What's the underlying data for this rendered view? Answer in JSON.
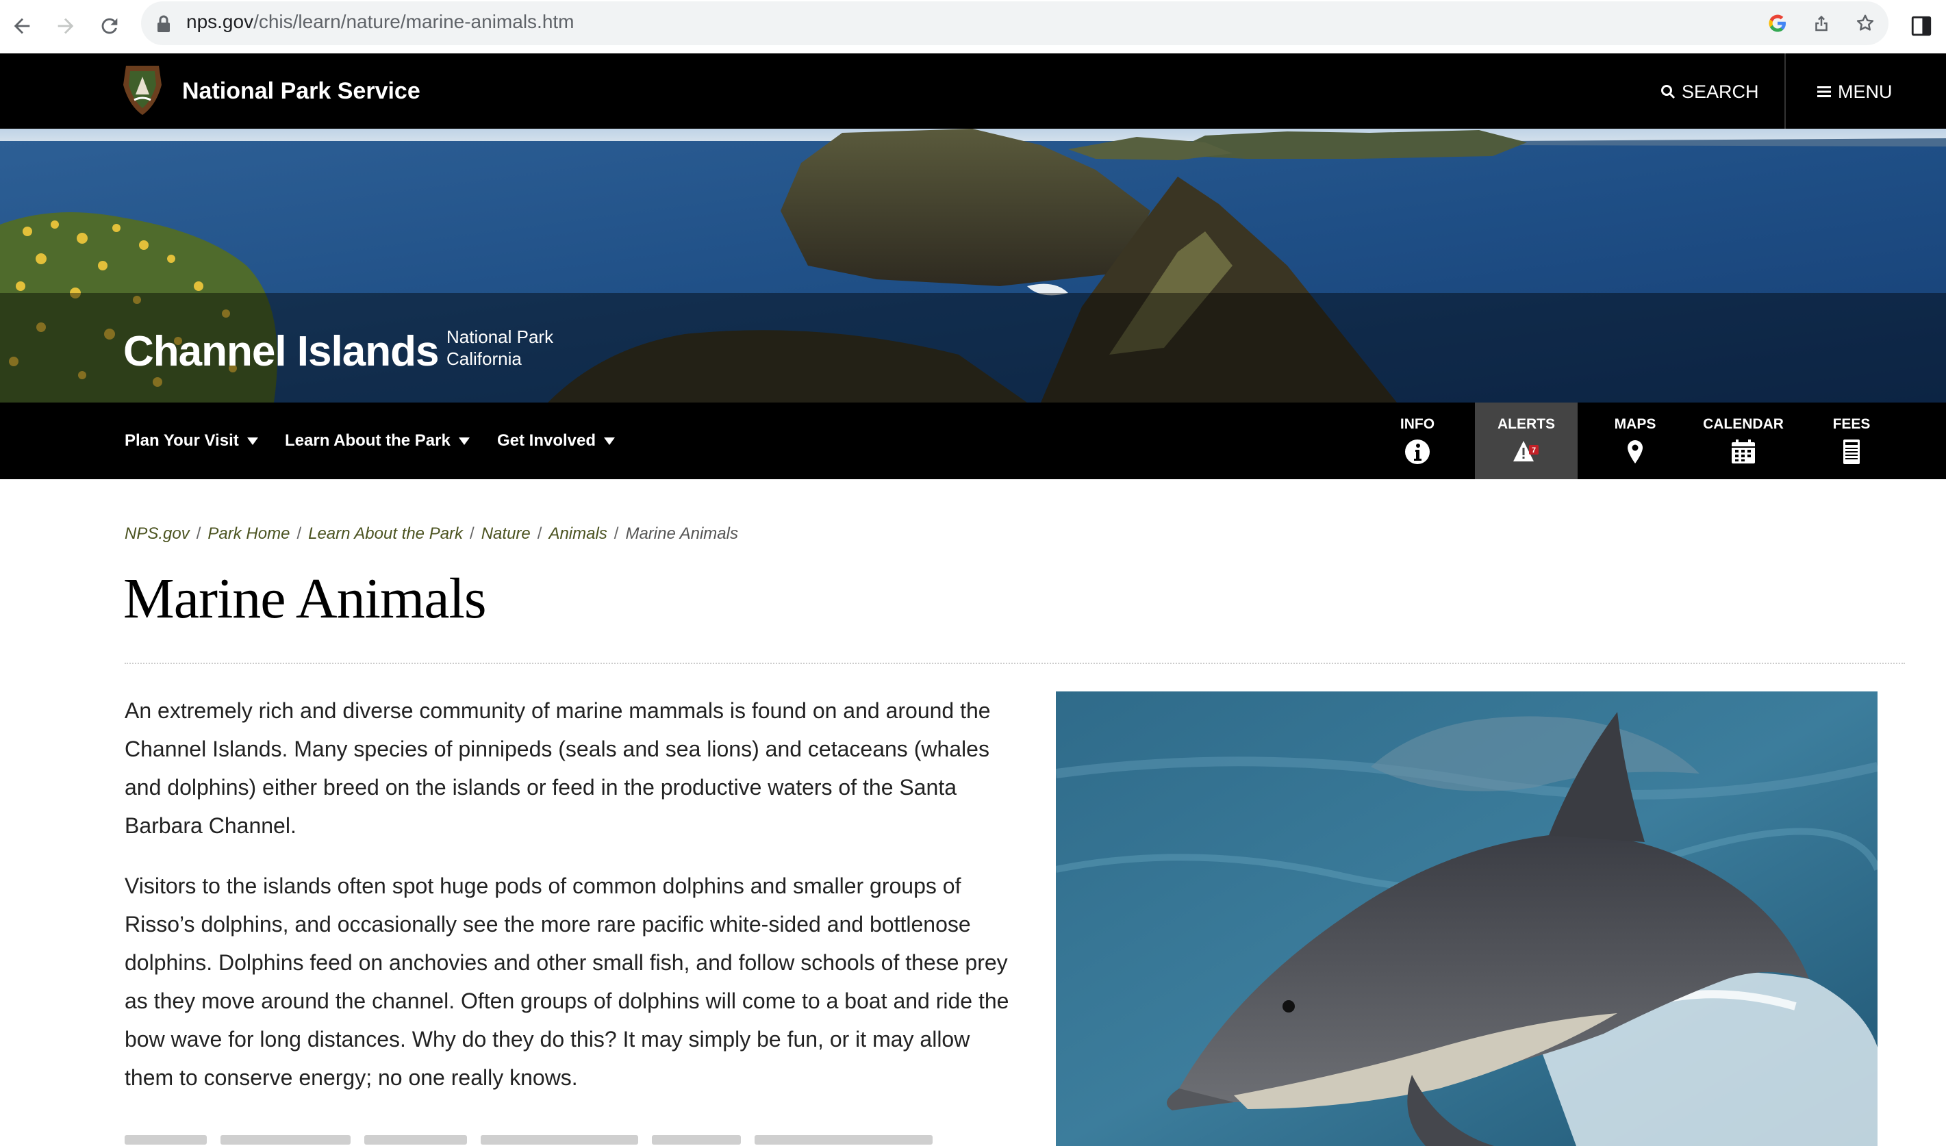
{
  "browser": {
    "url_host": "nps.gov",
    "url_path": "/chis/learn/nature/marine-animals.htm"
  },
  "header": {
    "site_name": "National Park Service",
    "search_label": "SEARCH",
    "menu_label": "MENU"
  },
  "hero": {
    "park_name": "Channel Islands",
    "designation": "National Park",
    "state": "California"
  },
  "park_nav": {
    "items": [
      {
        "label": "Plan Your Visit"
      },
      {
        "label": "Learn About the Park"
      },
      {
        "label": "Get Involved"
      }
    ],
    "quick_links": [
      {
        "label": "INFO",
        "icon": "info-icon"
      },
      {
        "label": "ALERTS",
        "icon": "alert-icon",
        "count": "7"
      },
      {
        "label": "MAPS",
        "icon": "map-pin-icon"
      },
      {
        "label": "CALENDAR",
        "icon": "calendar-icon"
      },
      {
        "label": "FEES",
        "icon": "fees-icon"
      }
    ]
  },
  "breadcrumb": {
    "items": [
      "NPS.gov",
      "Park Home",
      "Learn About the Park",
      "Nature",
      "Animals"
    ],
    "current": "Marine Animals"
  },
  "page": {
    "title": "Marine Animals",
    "paragraphs": [
      "An extremely rich and diverse community of marine mammals is found on and around the Channel Islands. Many species of pinnipeds (seals and sea lions) and cetaceans (whales and dolphins) either breed on the islands or feed in the productive waters of the Santa Barbara Channel.",
      "Visitors to the islands often spot huge pods of common dolphins and smaller groups of Risso’s dolphins, and occasionally see the more rare pacific white-sided and bottlenose dolphins. Dolphins feed on anchovies and other small fish, and follow schools of these prey as they move around the channel. Often groups of dolphins will come to a boat and ride the bow wave for long distances. Why do they do this? It may simply be fun, or it may allow them to conserve energy; no one really knows."
    ]
  },
  "colors": {
    "header_bg": "#000000",
    "breadcrumb_link": "#4b5320",
    "alerts_active_bg": "#444444"
  }
}
